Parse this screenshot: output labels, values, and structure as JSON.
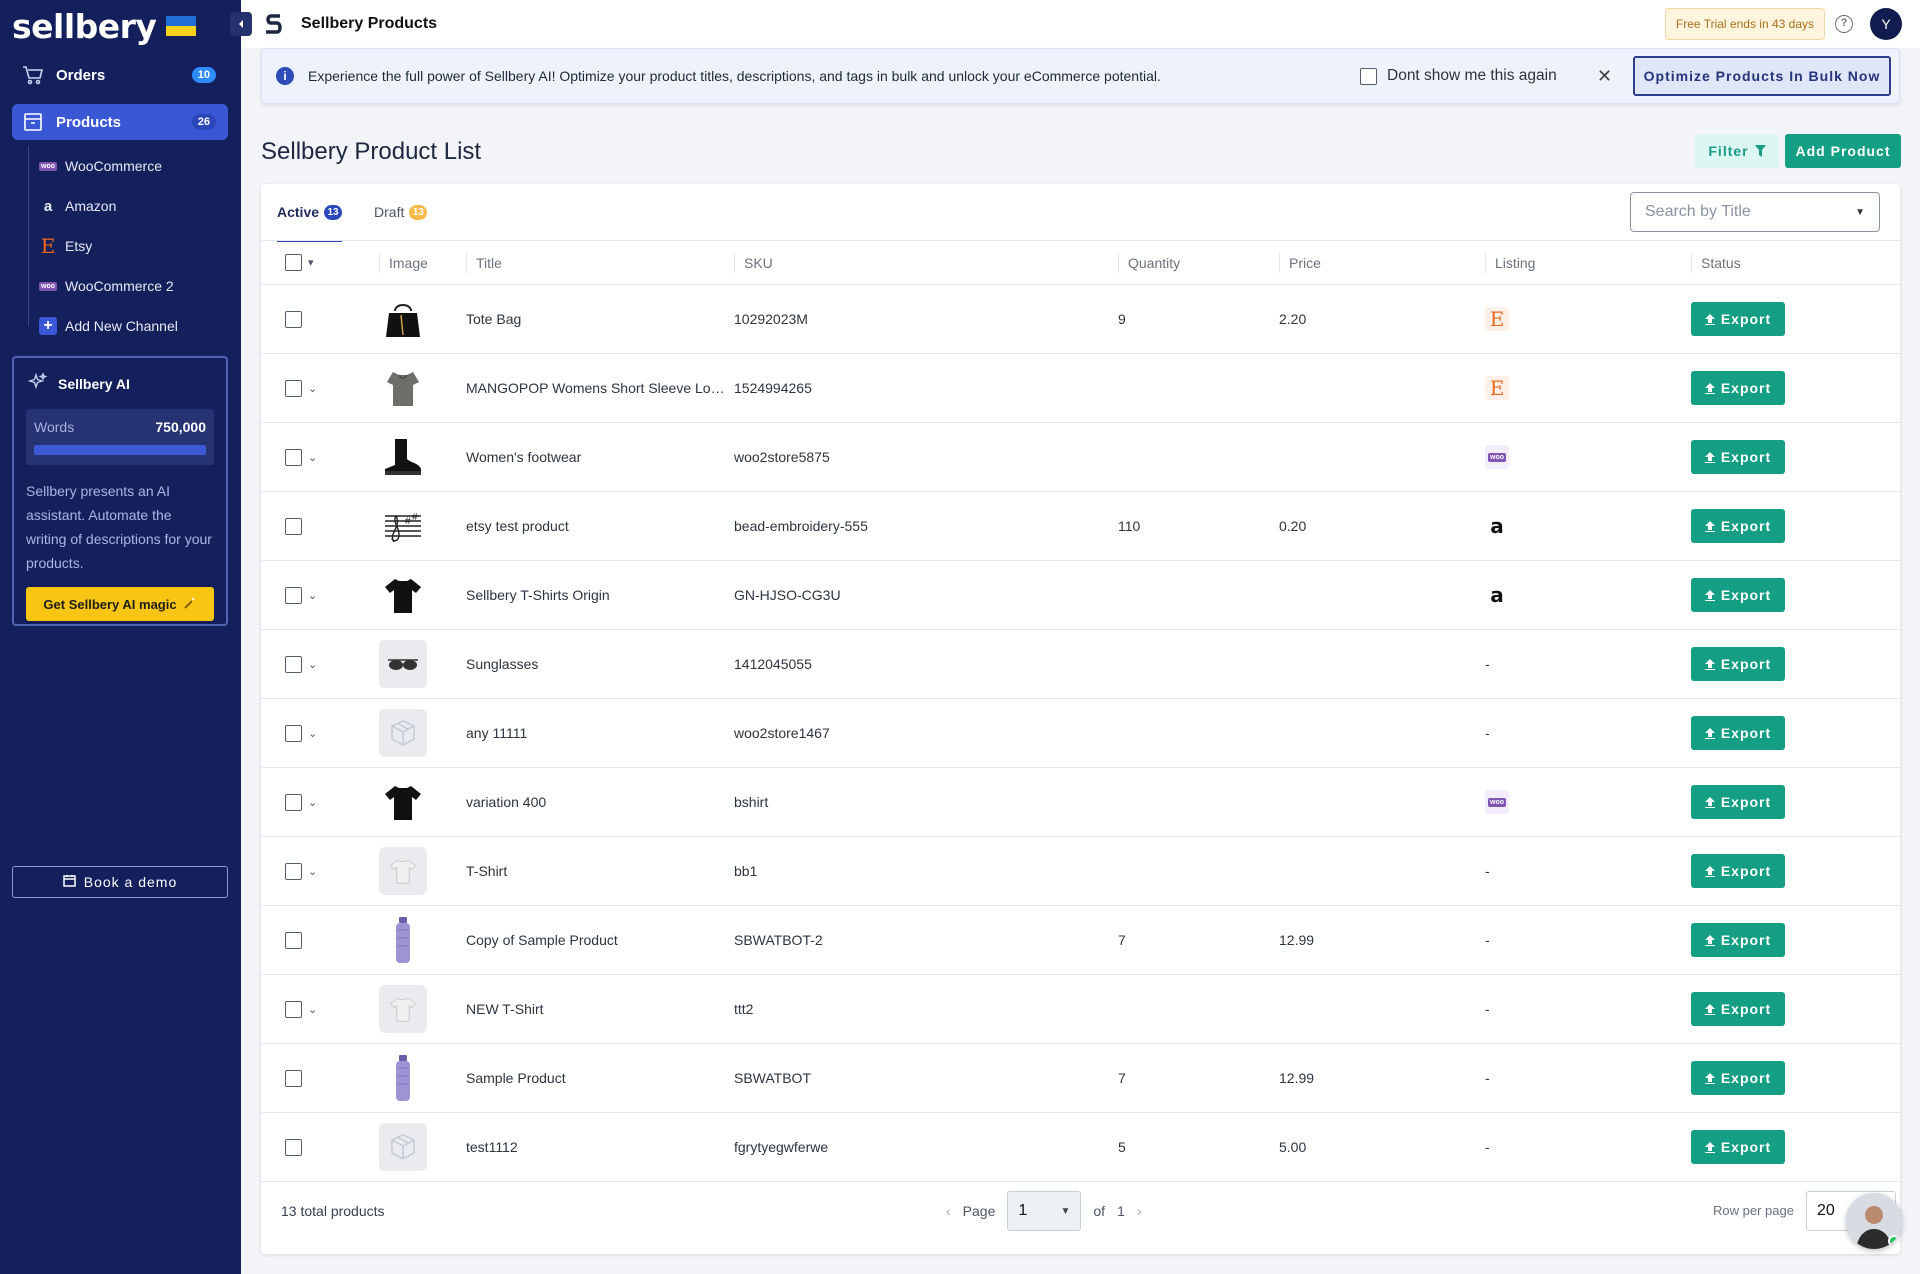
{
  "app": {
    "logo_text": "sellbery",
    "header_title": "Sellbery Products",
    "trial_text": "Free Trial ends in 43 days",
    "avatar_initial": "Y"
  },
  "sidebar": {
    "orders": {
      "label": "Orders",
      "count": "10"
    },
    "products": {
      "label": "Products",
      "count": "26"
    },
    "channels": [
      {
        "label": "WooCommerce",
        "icon": "woo-icon"
      },
      {
        "label": "Amazon",
        "icon": "amazon-icon"
      },
      {
        "label": "Etsy",
        "icon": "etsy-icon"
      },
      {
        "label": "WooCommerce 2",
        "icon": "woo-icon"
      },
      {
        "label": "Add New Channel",
        "icon": "plus-icon"
      }
    ],
    "ai": {
      "title": "Sellbery AI",
      "words_label": "Words",
      "words_value": "750,000",
      "description": "Sellbery presents an AI assistant. Automate the writing of descriptions for your products.",
      "button": "Get Sellbery AI magic"
    },
    "book_demo": "Book a demo"
  },
  "banner": {
    "message": "Experience the full power of Sellbery AI! Optimize your product titles, descriptions, and tags in bulk and unlock your eCommerce potential.",
    "dont_show": "Dont show me this again",
    "optimize_button": "Optimize Products In Bulk Now"
  },
  "page": {
    "title": "Sellbery Product List",
    "filter_label": "Filter",
    "add_label": "Add Product"
  },
  "tabs": [
    {
      "label": "Active",
      "count": "13"
    },
    {
      "label": "Draft",
      "count": "13"
    }
  ],
  "search": {
    "placeholder": "Search by Title"
  },
  "table": {
    "columns": [
      "Image",
      "Title",
      "SKU",
      "Quantity",
      "Price",
      "Listing",
      "Status"
    ],
    "export_label": "Export",
    "rows": [
      {
        "title": "Tote Bag",
        "sku": "10292023M",
        "qty": "9",
        "price": "2.20",
        "listing": "etsy",
        "image": "bag-icon",
        "expand": false
      },
      {
        "title": "MANGOPOP Womens Short Sleeve Lon...",
        "sku": "1524994265",
        "qty": "",
        "price": "",
        "listing": "etsy",
        "image": "top-icon",
        "expand": true
      },
      {
        "title": "Women's footwear",
        "sku": "woo2store5875",
        "qty": "",
        "price": "",
        "listing": "woo",
        "image": "boot-icon",
        "expand": true
      },
      {
        "title": "etsy test product",
        "sku": "bead-embroidery-555",
        "qty": "110",
        "price": "0.20",
        "listing": "amazon",
        "image": "music-icon",
        "expand": false
      },
      {
        "title": "Sellbery T-Shirts Origin",
        "sku": "GN-HJSO-CG3U",
        "qty": "",
        "price": "",
        "listing": "amazon",
        "image": "tshirt-black-icon",
        "expand": true
      },
      {
        "title": "Sunglasses",
        "sku": "1412045055",
        "qty": "",
        "price": "",
        "listing": "-",
        "image": "sunglasses-icon",
        "expand": true
      },
      {
        "title": "any 11111",
        "sku": "woo2store1467",
        "qty": "",
        "price": "",
        "listing": "-",
        "image": "placeholder-icon",
        "expand": true
      },
      {
        "title": "variation 400",
        "sku": "bshirt",
        "qty": "",
        "price": "",
        "listing": "woo",
        "image": "tshirt-black-icon",
        "expand": true
      },
      {
        "title": "T-Shirt",
        "sku": "bb1",
        "qty": "",
        "price": "",
        "listing": "-",
        "image": "tshirt-grey-icon",
        "expand": true
      },
      {
        "title": "Copy of Sample Product",
        "sku": "SBWATBOT-2",
        "qty": "7",
        "price": "12.99",
        "listing": "-",
        "image": "bottle-icon",
        "expand": false
      },
      {
        "title": "NEW T-Shirt",
        "sku": "ttt2",
        "qty": "",
        "price": "",
        "listing": "-",
        "image": "tshirt-grey-icon",
        "expand": true
      },
      {
        "title": "Sample Product",
        "sku": "SBWATBOT",
        "qty": "7",
        "price": "12.99",
        "listing": "-",
        "image": "bottle-icon",
        "expand": false
      },
      {
        "title": "test1112",
        "sku": "fgrytyegwferwe",
        "qty": "5",
        "price": "5.00",
        "listing": "-",
        "image": "placeholder-icon",
        "expand": false
      }
    ]
  },
  "footer": {
    "total": "13 total products",
    "page_label": "Page",
    "page_value": "1",
    "of_label": "of",
    "of_value": "1",
    "rows_label": "Row per page",
    "rows_value": "20"
  },
  "colors": {
    "sidebar": "#14205c",
    "accent": "#149e84",
    "active_nav": "#3a57d6",
    "ai_button": "#f8c514"
  }
}
